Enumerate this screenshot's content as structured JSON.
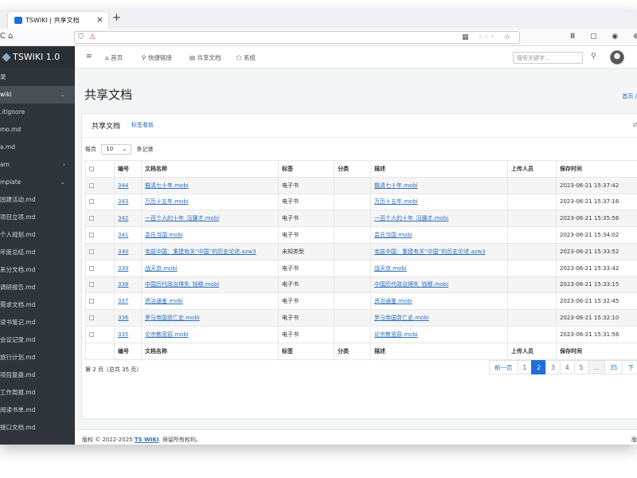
{
  "browser": {
    "tab_title": "TSWIKI | 共享文档",
    "tab_close": "×",
    "new_tab": "+",
    "nav_left": "C ⌂",
    "url_icons_right": "▦ ··· ☆",
    "toolbar_icons": "Ⅲ ▢ ◉ ⊕ ⟲"
  },
  "sidebar": {
    "brand": "TSWIKI 1.0",
    "items": [
      {
        "label": "录"
      },
      {
        "label": "wiki",
        "active": true,
        "caret": "⌄"
      },
      {
        "label": ".itignore"
      },
      {
        "label": "mo.md"
      },
      {
        "label": "a.md"
      },
      {
        "label": "am",
        "caret": "›"
      },
      {
        "label": "mplate",
        "caret": "⌄"
      },
      {
        "label": "团建活动.md"
      },
      {
        "label": "项目立项.md"
      },
      {
        "label": "个人规划.md"
      },
      {
        "label": "年度总结.md"
      },
      {
        "label": "系分文档.md"
      },
      {
        "label": "调研报告.md"
      },
      {
        "label": "需求文档.md"
      },
      {
        "label": "读书笔记.md"
      },
      {
        "label": "会议记录.md"
      },
      {
        "label": "旅行计划.md"
      },
      {
        "label": "项目复盘.md"
      },
      {
        "label": "工作周报.md"
      },
      {
        "label": "阅读书单.md"
      },
      {
        "label": "接口文档.md"
      }
    ]
  },
  "topnav": {
    "menu_icon": "≡",
    "items": [
      {
        "icon": "⌂",
        "label": "首页"
      },
      {
        "icon": "⚲",
        "label": "快捷链接"
      },
      {
        "icon": "▤",
        "label": "共享文档"
      },
      {
        "icon": "⬡",
        "label": "系统"
      }
    ],
    "search_placeholder": "搜索关键字...",
    "search_icon": "⚲"
  },
  "page": {
    "title": "共享文档",
    "breadcrumb": "首页 /"
  },
  "card": {
    "title": "共享文档",
    "link": "标签看板",
    "corner_icon": "⊘"
  },
  "per_page": {
    "prefix": "每页",
    "value": "10",
    "suffix": "条记录",
    "caret": "⌄"
  },
  "table": {
    "headers": [
      "",
      "编号",
      "文档名称",
      "标签",
      "分类",
      "描述",
      "上传人员",
      "保存时间"
    ],
    "rows": [
      {
        "id": "344",
        "name": "檐清七十年.mobi",
        "tag": "电子书",
        "cat": "",
        "desc": "檐清七十年.mobi",
        "uploader": "",
        "time": "2023-06-21 15:37:42"
      },
      {
        "id": "343",
        "name": "万历十五年.mobi",
        "tag": "电子书",
        "cat": "",
        "desc": "万历十五年.mobi",
        "uploader": "",
        "time": "2023-06-21 15:37:16"
      },
      {
        "id": "342",
        "name": "一百个人的十年_冯骥才.mobi",
        "tag": "电子书",
        "cat": "",
        "desc": "一百个人的十年_冯骥才.mobi",
        "uploader": "",
        "time": "2023-06-21 15:35:56"
      },
      {
        "id": "341",
        "name": "袁氏当国.mobi",
        "tag": "电子书",
        "cat": "",
        "desc": "袁氏当国.mobi",
        "uploader": "",
        "time": "2023-06-21 15:34:02"
      },
      {
        "id": "340",
        "name": "宅兹中国：重建有关“中国”的历史论述.azw3",
        "tag": "未知类型",
        "cat": "",
        "desc": "宅兹中国：重建有关“中国”的历史论述.azw3",
        "uploader": "",
        "time": "2023-06-21 15:33:52"
      },
      {
        "id": "339",
        "name": "战天京.mobi",
        "tag": "电子书",
        "cat": "",
        "desc": "战天京.mobi",
        "uploader": "",
        "time": "2023-06-21 15:33:42"
      },
      {
        "id": "338",
        "name": "中国历代政治得失_钱穆.mobi",
        "tag": "电子书",
        "cat": "",
        "desc": "中国历代政治得失_钱穆.mobi",
        "uploader": "",
        "time": "2023-06-21 15:33:15"
      },
      {
        "id": "337",
        "name": "资治通鉴.mobi",
        "tag": "电子书",
        "cat": "",
        "desc": "资治通鉴.mobi",
        "uploader": "",
        "time": "2023-06-21 15:32:45"
      },
      {
        "id": "336",
        "name": "罗马帝国衰亡史.mobi",
        "tag": "电子书",
        "cat": "",
        "desc": "罗马帝国衰亡史.mobi",
        "uploader": "",
        "time": "2023-06-21 15:32:10"
      },
      {
        "id": "335",
        "name": "论宗教宽容.mobi",
        "tag": "电子书",
        "cat": "",
        "desc": "论宗教宽容.mobi",
        "uploader": "",
        "time": "2023-06-21 15:31:56"
      }
    ]
  },
  "total_text": "第 2 页（总共 35 页）",
  "pagination": [
    {
      "label": "前一页",
      "state": "normal"
    },
    {
      "label": "1",
      "state": "normal"
    },
    {
      "label": "2",
      "state": "active"
    },
    {
      "label": "3",
      "state": "normal"
    },
    {
      "label": "4",
      "state": "normal"
    },
    {
      "label": "5",
      "state": "normal"
    },
    {
      "label": "…",
      "state": "disabled"
    },
    {
      "label": "35",
      "state": "normal"
    },
    {
      "label": "下",
      "state": "normal"
    }
  ],
  "footer": {
    "prefix": "版权 © 2022-2025",
    "link": "TS WIKI",
    "suffix": ". 保留所有权利。",
    "right": "版"
  }
}
